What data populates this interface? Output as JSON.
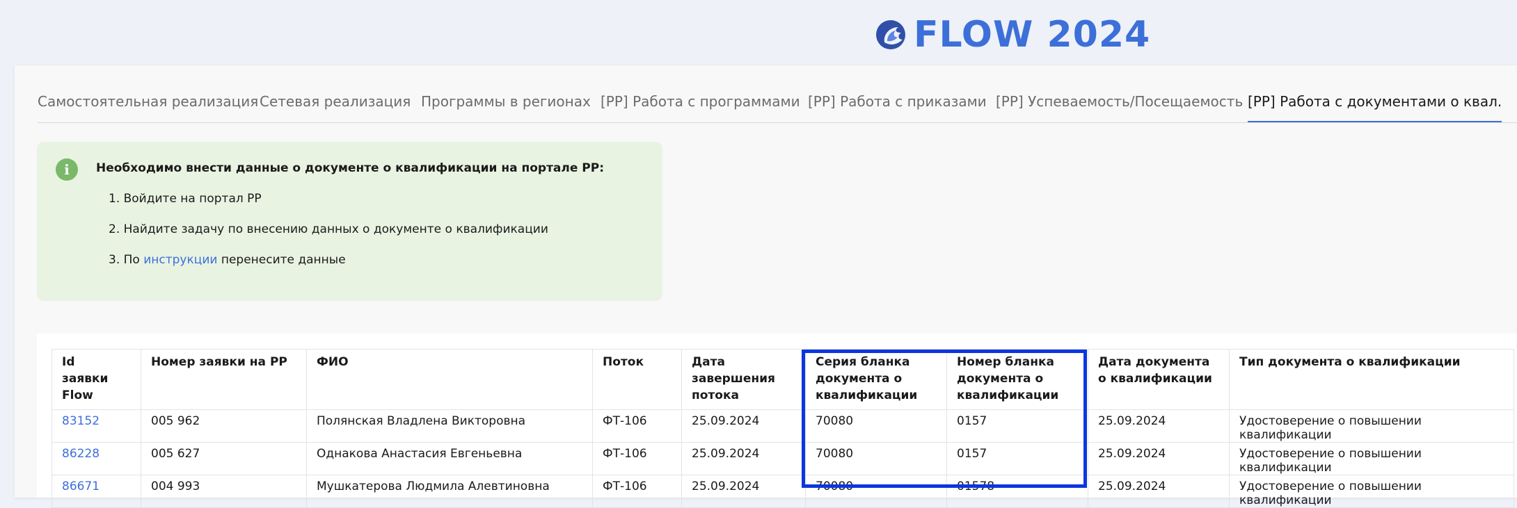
{
  "logo": {
    "text": "FLOW 2024",
    "icon": "flow-logo-icon",
    "color": "#3d6fd9"
  },
  "tabs": [
    {
      "label": "Самостоятельная реализация",
      "active": false
    },
    {
      "label": "Сетевая реализация",
      "active": false
    },
    {
      "label": "Программы в регионах",
      "active": false
    },
    {
      "label": "[РР] Работа с программами",
      "active": false
    },
    {
      "label": "[РР] Работа с приказами",
      "active": false
    },
    {
      "label": "[РР] Успеваемость/Посещаемость",
      "active": false
    },
    {
      "label": "[РР] Работа с документами о квал.",
      "active": true
    }
  ],
  "alert": {
    "icon": "info-icon",
    "title": "Необходимо внести данные о документе о квалификации на портале РР:",
    "steps": {
      "s1": "1. Войдите на портал РР",
      "s2": "2. Найдите задачу по внесению данных о документе о квалификации",
      "s3_prefix": "3. По ",
      "s3_link": "инструкции",
      "s3_suffix": " перенесите данные"
    },
    "color": "#e9f3e2"
  },
  "table": {
    "columns": [
      "Id заявки Flow",
      "Номер заявки на РР",
      "ФИО",
      "Поток",
      "Дата завершения потока",
      "Серия бланка документа о квалификации",
      "Номер бланка документа о квалификации",
      "Дата документа о квалификации",
      "Тип документа о квалификации"
    ],
    "rows": [
      [
        "83152",
        "005 962",
        "Полянская Владлена Викторовна",
        "ФТ-106",
        "25.09.2024",
        "70080",
        "0157",
        "25.09.2024",
        "Удостоверение о повышении квалификации"
      ],
      [
        "86228",
        "005 627",
        "Однакова Анастасия Евгеньевна",
        "ФТ-106",
        "25.09.2024",
        "70080",
        "0157",
        "25.09.2024",
        "Удостоверение о повышении квалификации"
      ],
      [
        "86671",
        "004 993",
        "Мушкатерова Людмила Алевтиновна",
        "ФТ-106",
        "25.09.2024",
        "70080",
        "01578",
        "25.09.2024",
        "Удостоверение о повышении квалификации"
      ]
    ]
  },
  "highlight_color": "#0c36e0"
}
